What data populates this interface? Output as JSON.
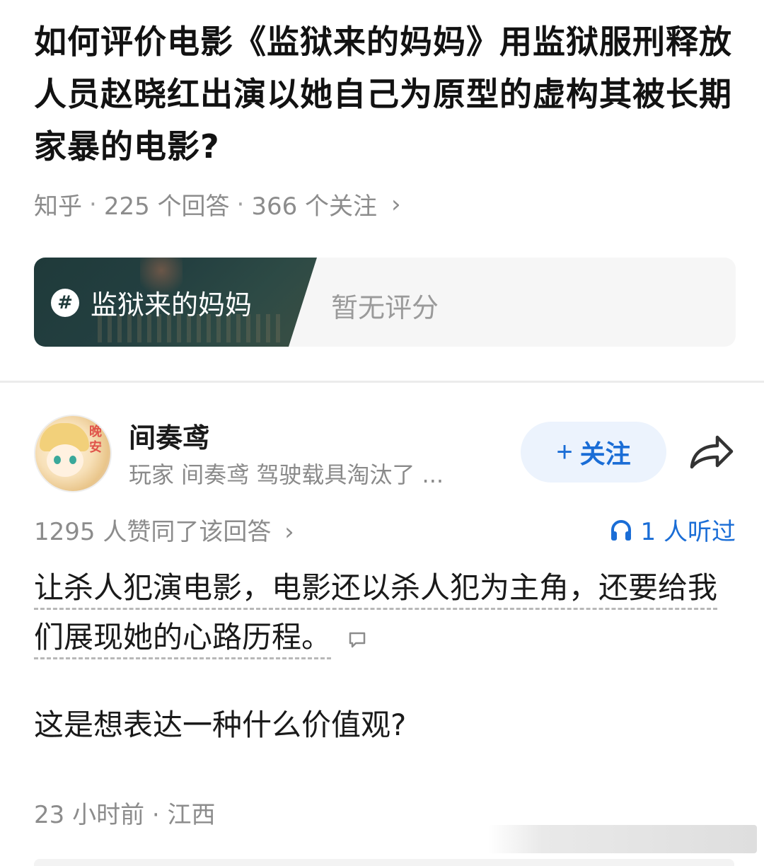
{
  "question": {
    "title": "如何评价电影《监狱来的妈妈》用监狱服刑释放人员赵晓红出演以她自己为原型的虚构其被长期家暴的电影?",
    "source": "知乎",
    "separator": "·",
    "answers_count": "225 个回答",
    "followers_count": "366 个关注",
    "chevron": "›"
  },
  "topic_card": {
    "badge": "#",
    "name": "监狱来的妈妈",
    "rating": "暂无评分"
  },
  "author": {
    "name": "间奏鸢",
    "bio": "玩家 间奏鸢 驾驶载具淘汰了 ...",
    "avatar_badge_text": "晚安",
    "follow_plus": "+",
    "follow_label": "关注"
  },
  "answer": {
    "agree_text": "1295 人赞同了该回答",
    "agree_chevron": "›",
    "listened_text": "1 人听过",
    "paragraph_1": "让杀人犯演电影，电影还以杀人犯为主角，还要给我们展现她的心路历程。",
    "paragraph_2": "这是想表达一种什么价值观?",
    "time": "23 小时前",
    "time_separator": "·",
    "location": "江西"
  },
  "colors": {
    "accent_blue": "#1a6dd6",
    "follow_bg": "#ecf3fd",
    "meta_gray": "#8c8c8c",
    "topic_dark": "#1f3a3a"
  },
  "icons": {
    "share": "share-arrow-icon",
    "headphones": "headphones-icon",
    "comment": "comment-bubble-icon",
    "topic": "hash-icon"
  }
}
